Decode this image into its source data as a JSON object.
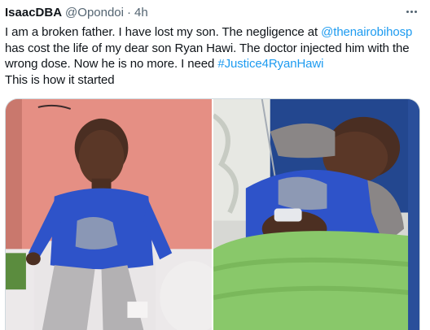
{
  "author": {
    "display_name": "IsaacDBA",
    "handle": "@Opondoi",
    "separator": "·",
    "time": "4h"
  },
  "more_icon": "more-horizontal-icon",
  "tweet": {
    "t1": "I am a broken father. I have lost my son. The negligence at ",
    "mention": "@thenairobihosp",
    "t2": " has cost the life of my dear son Ryan Hawi. The doctor injected him with the wrong dose. Now he is no more. I need ",
    "hashtag": "#Justice4RyanHawi",
    "t3": "This is how it started"
  },
  "colors": {
    "link": "#1d9bf0",
    "secondary_text": "#536471",
    "primary_text": "#0f1419"
  }
}
